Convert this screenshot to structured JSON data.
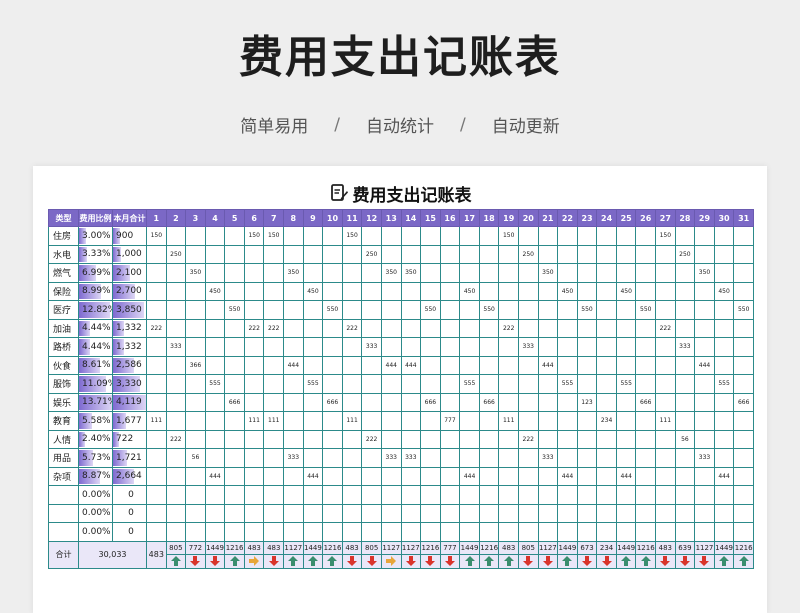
{
  "title": "费用支出记账表",
  "tagline": [
    "简单易用",
    "自动统计",
    "自动更新"
  ],
  "tagline_sep": "/",
  "sheet_title": "费用支出记账表",
  "colors": {
    "header": "#7b68c6",
    "grid": "#2c8a8a",
    "up": "#3a8d6e",
    "down": "#d9342b",
    "flat": "#e7a63a"
  },
  "headers": {
    "type": "类型",
    "pct": "费用比例",
    "total": "本月合计",
    "days": [
      "1",
      "2",
      "3",
      "4",
      "5",
      "6",
      "7",
      "8",
      "9",
      "10",
      "11",
      "12",
      "13",
      "14",
      "15",
      "16",
      "17",
      "18",
      "19",
      "20",
      "21",
      "22",
      "23",
      "24",
      "25",
      "26",
      "27",
      "28",
      "29",
      "30",
      "31"
    ]
  },
  "rows": [
    {
      "type": "住房",
      "pct": "3.00%",
      "pct_value": 3.0,
      "total": "900",
      "days": [
        "150",
        "",
        "",
        "",
        "",
        "150",
        "150",
        "",
        "",
        "",
        "150",
        "",
        "",
        "",
        "",
        "",
        "",
        "",
        "150",
        "",
        "",
        "",
        "",
        "",
        "",
        "",
        "150",
        "",
        "",
        "",
        ""
      ]
    },
    {
      "type": "水电",
      "pct": "3.33%",
      "pct_value": 3.33,
      "total": "1,000",
      "days": [
        "",
        "250",
        "",
        "",
        "",
        "",
        "",
        "",
        "",
        "",
        "",
        "250",
        "",
        "",
        "",
        "",
        "",
        "",
        "",
        "250",
        "",
        "",
        "",
        "",
        "",
        "",
        "",
        "250",
        "",
        "",
        ""
      ]
    },
    {
      "type": "燃气",
      "pct": "6.99%",
      "pct_value": 6.99,
      "total": "2,100",
      "days": [
        "",
        "",
        "350",
        "",
        "",
        "",
        "",
        "350",
        "",
        "",
        "",
        "",
        "350",
        "350",
        "",
        "",
        "",
        "",
        "",
        "",
        "350",
        "",
        "",
        "",
        "",
        "",
        "",
        "",
        "350",
        "",
        ""
      ]
    },
    {
      "type": "保险",
      "pct": "8.99%",
      "pct_value": 8.99,
      "total": "2,700",
      "days": [
        "",
        "",
        "",
        "450",
        "",
        "",
        "",
        "",
        "450",
        "",
        "",
        "",
        "",
        "",
        "",
        "",
        "450",
        "",
        "",
        "",
        "",
        "450",
        "",
        "",
        "450",
        "",
        "",
        "",
        "",
        "450",
        ""
      ]
    },
    {
      "type": "医疗",
      "pct": "12.82%",
      "pct_value": 12.82,
      "total": "3,850",
      "days": [
        "",
        "",
        "",
        "",
        "550",
        "",
        "",
        "",
        "",
        "550",
        "",
        "",
        "",
        "",
        "550",
        "",
        "",
        "550",
        "",
        "",
        "",
        "",
        "550",
        "",
        "",
        "550",
        "",
        "",
        "",
        "",
        "550"
      ]
    },
    {
      "type": "加油",
      "pct": "4.44%",
      "pct_value": 4.44,
      "total": "1,332",
      "days": [
        "222",
        "",
        "",
        "",
        "",
        "222",
        "222",
        "",
        "",
        "",
        "222",
        "",
        "",
        "",
        "",
        "",
        "",
        "",
        "222",
        "",
        "",
        "",
        "",
        "",
        "",
        "",
        "222",
        "",
        "",
        "",
        ""
      ]
    },
    {
      "type": "路桥",
      "pct": "4.44%",
      "pct_value": 4.44,
      "total": "1,332",
      "days": [
        "",
        "333",
        "",
        "",
        "",
        "",
        "",
        "",
        "",
        "",
        "",
        "333",
        "",
        "",
        "",
        "",
        "",
        "",
        "",
        "333",
        "",
        "",
        "",
        "",
        "",
        "",
        "",
        "333",
        "",
        "",
        ""
      ]
    },
    {
      "type": "伙食",
      "pct": "8.61%",
      "pct_value": 8.61,
      "total": "2,586",
      "days": [
        "",
        "",
        "366",
        "",
        "",
        "",
        "",
        "444",
        "",
        "",
        "",
        "",
        "444",
        "444",
        "",
        "",
        "",
        "",
        "",
        "",
        "444",
        "",
        "",
        "",
        "",
        "",
        "",
        "",
        "444",
        "",
        ""
      ]
    },
    {
      "type": "服饰",
      "pct": "11.09%",
      "pct_value": 11.09,
      "total": "3,330",
      "days": [
        "",
        "",
        "",
        "555",
        "",
        "",
        "",
        "",
        "555",
        "",
        "",
        "",
        "",
        "",
        "",
        "",
        "555",
        "",
        "",
        "",
        "",
        "555",
        "",
        "",
        "555",
        "",
        "",
        "",
        "",
        "555",
        ""
      ]
    },
    {
      "type": "娱乐",
      "pct": "13.71%",
      "pct_value": 13.71,
      "total": "4,119",
      "days": [
        "",
        "",
        "",
        "",
        "666",
        "",
        "",
        "",
        "",
        "666",
        "",
        "",
        "",
        "",
        "666",
        "",
        "",
        "666",
        "",
        "",
        "",
        "",
        "123",
        "",
        "",
        "666",
        "",
        "",
        "",
        "",
        "666"
      ]
    },
    {
      "type": "教育",
      "pct": "5.58%",
      "pct_value": 5.58,
      "total": "1,677",
      "days": [
        "111",
        "",
        "",
        "",
        "",
        "111",
        "111",
        "",
        "",
        "",
        "111",
        "",
        "",
        "",
        "",
        "777",
        "",
        "",
        "111",
        "",
        "",
        "",
        "",
        "234",
        "",
        "",
        "111",
        "",
        "",
        "",
        ""
      ]
    },
    {
      "type": "人情",
      "pct": "2.40%",
      "pct_value": 2.4,
      "total": "722",
      "days": [
        "",
        "222",
        "",
        "",
        "",
        "",
        "",
        "",
        "",
        "",
        "",
        "222",
        "",
        "",
        "",
        "",
        "",
        "",
        "",
        "222",
        "",
        "",
        "",
        "",
        "",
        "",
        "",
        "56",
        "",
        "",
        ""
      ]
    },
    {
      "type": "用品",
      "pct": "5.73%",
      "pct_value": 5.73,
      "total": "1,721",
      "days": [
        "",
        "",
        "56",
        "",
        "",
        "",
        "",
        "333",
        "",
        "",
        "",
        "",
        "333",
        "333",
        "",
        "",
        "",
        "",
        "",
        "",
        "333",
        "",
        "",
        "",
        "",
        "",
        "",
        "",
        "333",
        "",
        ""
      ]
    },
    {
      "type": "杂项",
      "pct": "8.87%",
      "pct_value": 8.87,
      "total": "2,664",
      "days": [
        "",
        "",
        "",
        "444",
        "",
        "",
        "",
        "",
        "444",
        "",
        "",
        "",
        "",
        "",
        "",
        "",
        "444",
        "",
        "",
        "",
        "",
        "444",
        "",
        "",
        "444",
        "",
        "",
        "",
        "",
        "444",
        ""
      ]
    },
    {
      "type": "",
      "pct": "0.00%",
      "pct_value": 0,
      "total": "0",
      "days": [
        "",
        "",
        "",
        "",
        "",
        "",
        "",
        "",
        "",
        "",
        "",
        "",
        "",
        "",
        "",
        "",
        "",
        "",
        "",
        "",
        "",
        "",
        "",
        "",
        "",
        "",
        "",
        "",
        "",
        "",
        ""
      ]
    },
    {
      "type": "",
      "pct": "0.00%",
      "pct_value": 0,
      "total": "0",
      "days": [
        "",
        "",
        "",
        "",
        "",
        "",
        "",
        "",
        "",
        "",
        "",
        "",
        "",
        "",
        "",
        "",
        "",
        "",
        "",
        "",
        "",
        "",
        "",
        "",
        "",
        "",
        "",
        "",
        "",
        "",
        ""
      ]
    },
    {
      "type": "",
      "pct": "0.00%",
      "pct_value": 0,
      "total": "0",
      "days": [
        "",
        "",
        "",
        "",
        "",
        "",
        "",
        "",
        "",
        "",
        "",
        "",
        "",
        "",
        "",
        "",
        "",
        "",
        "",
        "",
        "",
        "",
        "",
        "",
        "",
        "",
        "",
        "",
        "",
        "",
        ""
      ]
    }
  ],
  "summary": {
    "label": "合计",
    "grand_total": "30,033",
    "day_totals": [
      "483",
      "805",
      "772",
      "1449",
      "1216",
      "483",
      "483",
      "1127",
      "1449",
      "1216",
      "483",
      "805",
      "1127",
      "1127",
      "1216",
      "777",
      "1449",
      "1216",
      "483",
      "805",
      "1127",
      "1449",
      "673",
      "234",
      "1449",
      "1216",
      "483",
      "639",
      "1127",
      "1449",
      "1216"
    ],
    "trend_icons": [
      "up-icon",
      "up-icon",
      "down-icon",
      "down-icon",
      "up-icon",
      "flat-icon",
      "down-icon",
      "up-icon",
      "up-icon",
      "up-icon",
      "down-icon",
      "down-icon",
      "flat-icon",
      "down-icon",
      "down-icon",
      "down-icon",
      "up-icon",
      "up-icon",
      "up-icon",
      "down-icon",
      "down-icon",
      "up-icon",
      "down-icon",
      "down-icon",
      "up-icon",
      "up-icon",
      "down-icon",
      "down-icon",
      "down-icon",
      "up-icon",
      "up-icon"
    ]
  }
}
